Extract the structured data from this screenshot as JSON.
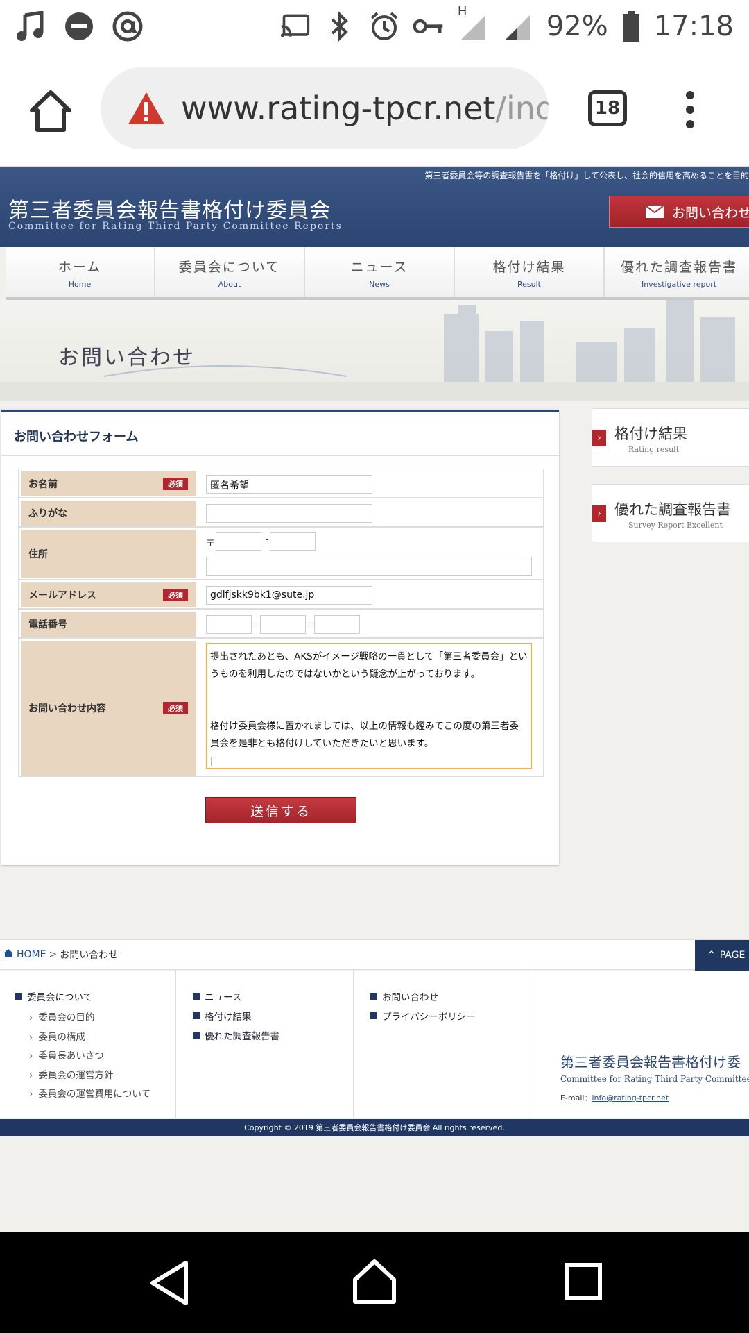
{
  "status_bar": {
    "battery": "92%",
    "time": "17:18",
    "signal_label": "H"
  },
  "browser": {
    "url_main": "www.rating-tpcr.net",
    "url_rest": "/inq",
    "tab_count": "18"
  },
  "header": {
    "tagline": "第三者委員会等の調査報告書を「格付け」して公表し、社会的信用を高めることを目的",
    "title": "第三者委員会報告書格付け委員会",
    "subtitle": "Committee for Rating Third Party Committee Reports",
    "contact_button": "お問い合わせ"
  },
  "nav": [
    {
      "jp": "ホーム",
      "en": "Home"
    },
    {
      "jp": "委員会について",
      "en": "About"
    },
    {
      "jp": "ニュース",
      "en": "News"
    },
    {
      "jp": "格付け結果",
      "en": "Result"
    },
    {
      "jp": "優れた調査報告書",
      "en": "Investigative report"
    }
  ],
  "banner": {
    "title": "お問い合わせ"
  },
  "form": {
    "heading": "お問い合わせフォーム",
    "required_label": "必須",
    "name_label": "お名前",
    "name_value": "匿名希望",
    "furigana_label": "ふりがな",
    "address_label": "住所",
    "postal_mark": "〒",
    "dash": "-",
    "email_label": "メールアドレス",
    "email_value": "gdlfjskk9bk1@sute.jp",
    "phone_label": "電話番号",
    "message_label": "お問い合わせ内容",
    "message_value": "提出されたあとも、AKSがイメージ戦略の一貫として「第三者委員会」というものを利用したのではないかという疑念が上がっております。\n\n\n格付け委員会様に置かれましては、以上の情報も鑑みてこの度の第三者委員会を是非とも格付けしていただきたいと思います。\n|",
    "submit": "送信する"
  },
  "sidebar": [
    {
      "title": "格付け結果",
      "sub": "Rating result"
    },
    {
      "title": "優れた調査報告書",
      "sub": "Survey Report Excellent"
    }
  ],
  "breadcrumb": {
    "home": "HOME",
    "sep": ">",
    "current": "お問い合わせ",
    "page_top": "PAGE"
  },
  "footer": {
    "col1_head": "委員会について",
    "col1_items": [
      "委員会の目的",
      "委員の構成",
      "委員長あいさつ",
      "委員会の運営方針",
      "委員会の運営費用について"
    ],
    "col2_items": [
      "ニュース",
      "格付け結果",
      "優れた調査報告書"
    ],
    "col3_items": [
      "お問い合わせ",
      "プライバシーポリシー"
    ],
    "logo_title": "第三者委員会報告書格付け委",
    "logo_sub": "Committee for Rating Third Party Committee",
    "email_label": "E-mail：",
    "email": "info@rating-tpcr.net"
  },
  "copyright": "Copyright © 2019 第三者委員会報告書格付け委員会 All rights reserved."
}
